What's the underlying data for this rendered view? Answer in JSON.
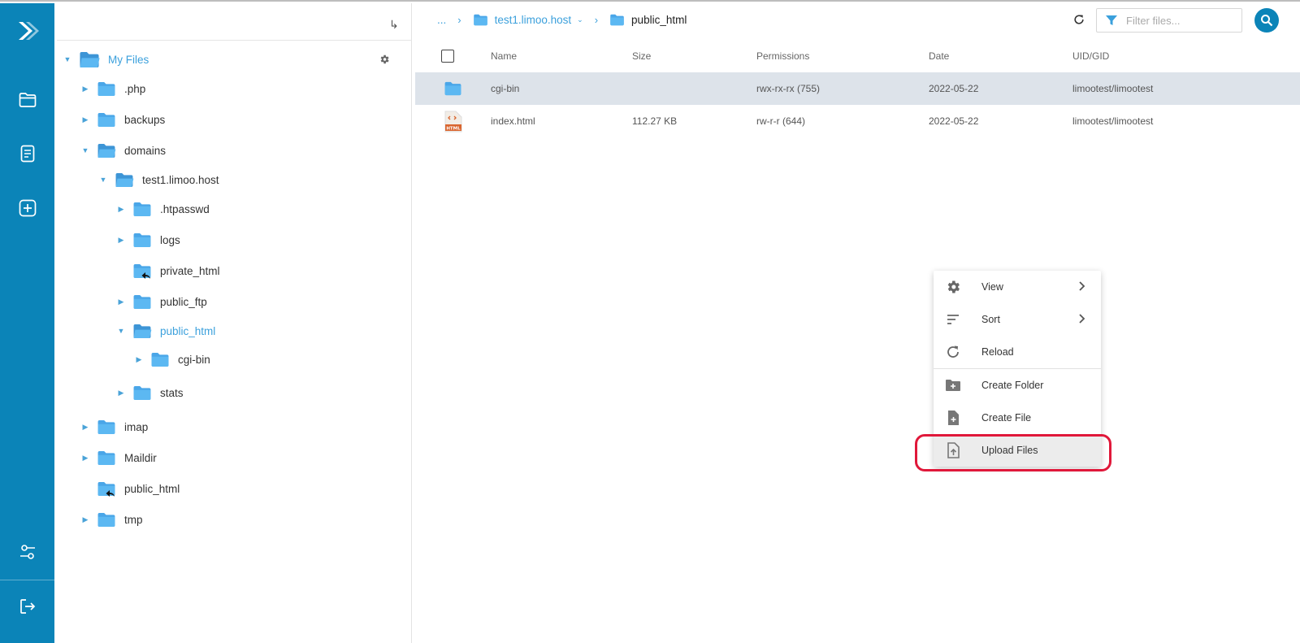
{
  "tree": {
    "root_label": "My Files",
    "nodes": [
      {
        "label": ".php"
      },
      {
        "label": "backups"
      },
      {
        "label": "domains"
      },
      {
        "label": "test1.limoo.host"
      },
      {
        "label": ".htpasswd"
      },
      {
        "label": "logs"
      },
      {
        "label": "private_html"
      },
      {
        "label": "public_ftp"
      },
      {
        "label": "public_html"
      },
      {
        "label": "cgi-bin"
      },
      {
        "label": "stats"
      },
      {
        "label": "imap"
      },
      {
        "label": "Maildir"
      },
      {
        "label": "public_html"
      },
      {
        "label": "tmp"
      }
    ]
  },
  "breadcrumb": {
    "ellipsis": "...",
    "domain": "test1.limoo.host",
    "current": "public_html"
  },
  "filter": {
    "placeholder": "Filter files..."
  },
  "table": {
    "columns": [
      "Name",
      "Size",
      "Permissions",
      "Date",
      "UID/GID"
    ],
    "rows": [
      {
        "name": "cgi-bin",
        "size": "",
        "permissions": "rwx-rx-rx (755)",
        "date": "2022-05-22",
        "uid": "limootest/limootest",
        "icon": "folder-icon"
      },
      {
        "name": "index.html",
        "size": "112.27 KB",
        "permissions": "rw-r-r (644)",
        "date": "2022-05-22",
        "uid": "limootest/limootest",
        "icon": "html-file-icon"
      }
    ]
  },
  "context_menu": {
    "items": [
      {
        "label": "View",
        "icon": "gear-icon"
      },
      {
        "label": "Sort",
        "icon": "sort-icon"
      },
      {
        "label": "Reload",
        "icon": "reload-icon"
      },
      {
        "label": "Create Folder",
        "icon": "add-folder-icon"
      },
      {
        "label": "Create File",
        "icon": "add-file-icon"
      },
      {
        "label": "Upload Files",
        "icon": "upload-icon"
      }
    ],
    "highlighted": "Upload Files"
  },
  "colors": {
    "brand": "#0b84b8",
    "accent": "#3ba0dc",
    "folder": "#5bb0ec",
    "highlight_ring": "#e0183a",
    "selected_row": "#dde3ea"
  }
}
